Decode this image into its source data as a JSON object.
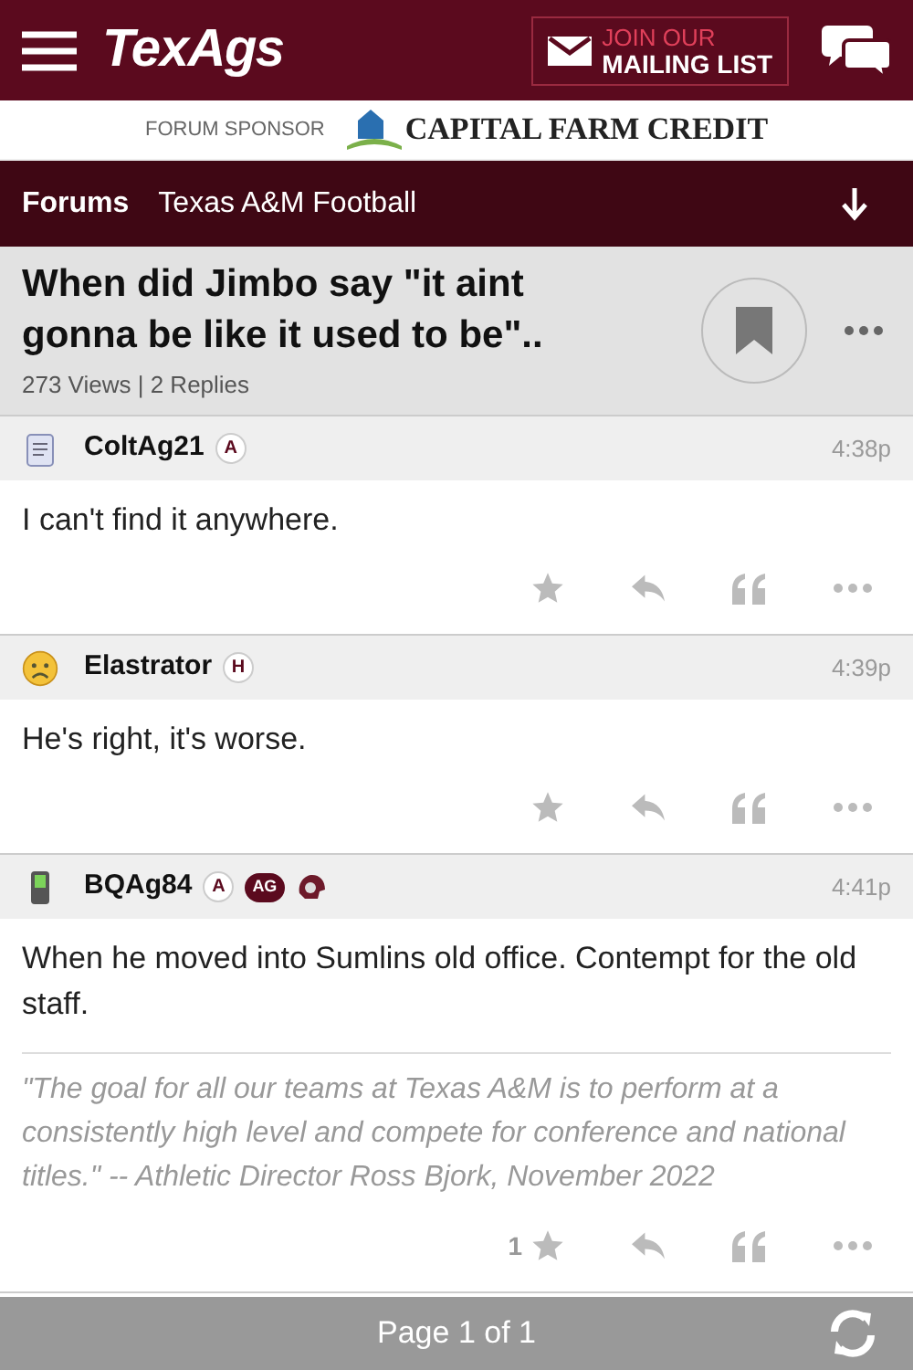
{
  "header": {
    "logo": "TexAgs",
    "mailing": {
      "line1": "JOIN OUR",
      "line2": "MAILING LIST"
    }
  },
  "sponsor": {
    "label": "FORUM SPONSOR",
    "name": "CAPITAL FARM CREDIT"
  },
  "breadcrumb": [
    {
      "label": "Forums",
      "bold": true
    },
    {
      "label": "Texas A&M Football",
      "bold": false
    }
  ],
  "thread": {
    "title": "When did Jimbo say \"it aint gonna be like it used to be\"..",
    "stats": "273 Views | 2 Replies",
    "bookmarked": false
  },
  "posts": [
    {
      "kind": "notepad",
      "user": "ColtAg21",
      "badges": [
        {
          "kind": "letter",
          "text": "A"
        }
      ],
      "time": "4:38p",
      "body": "I can't find it anywhere."
    },
    {
      "kind": "sad",
      "user": "Elastrator",
      "badges": [
        {
          "kind": "letter",
          "text": "H"
        }
      ],
      "time": "4:39p",
      "body": "He's right, it's worse."
    },
    {
      "kind": "phone",
      "user": "BQAg84",
      "badges": [
        {
          "kind": "letter",
          "text": "A"
        },
        {
          "kind": "pill",
          "text": "AG"
        },
        {
          "kind": "helmet"
        }
      ],
      "time": "4:41p",
      "body": "When he moved into Sumlins old office. Contempt for the old staff.",
      "signature": "\"The goal for all our teams at Texas A&M is to perform at a consistently high level and compete for conference and national titles.\" -- Athletic Director Ross Bjork, November 2022",
      "stars": "1"
    }
  ],
  "footer": {
    "page": "Page 1 of 1"
  }
}
